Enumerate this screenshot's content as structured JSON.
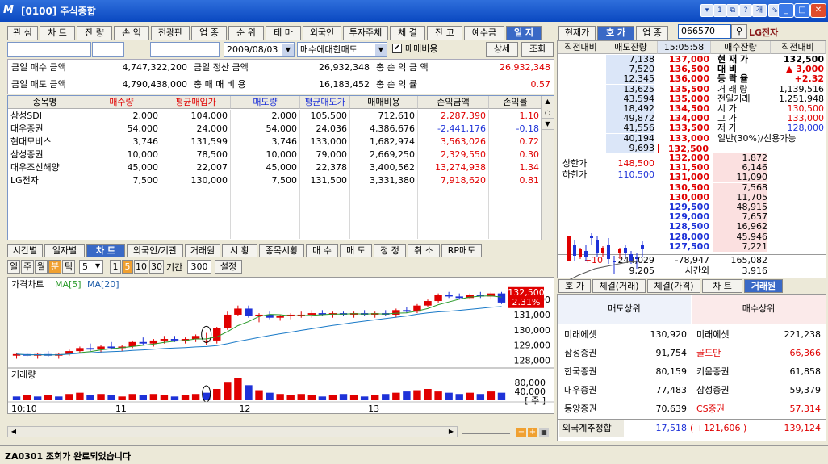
{
  "window": {
    "logo": "M",
    "title": "[0100] 주식종합",
    "tb_icons": [
      "▾",
      "1",
      "⧉",
      "?",
      "개",
      "⇘"
    ],
    "controls": [
      "_",
      "□",
      "✕"
    ]
  },
  "top_tabs": [
    "관 심",
    "차 트",
    "잔 량",
    "손 익",
    "전광판",
    "업 종",
    "순 위",
    "테 마",
    "외국인",
    "투자주체",
    "체 결",
    "잔 고",
    "예수금",
    "일 지"
  ],
  "toolbar": {
    "date": "2009/08/03",
    "mode": "매수에대한매도",
    "checkbox_label": "매매비용",
    "checked": true,
    "detail_btn": "상세",
    "query_btn": "조회"
  },
  "summary": [
    {
      "l1": "금일 매수 금액",
      "v1": "4,747,322,200",
      "l2": "금일 정산 금액",
      "v2": "26,932,348",
      "l3": "총 손 익 금 액",
      "v3": "26,932,348"
    },
    {
      "l1": "금일 매도 금액",
      "v1": "4,790,438,000",
      "l2": "총 매 매 비 용",
      "v2": "16,183,452",
      "l3": "총 손 익 률",
      "v3": "0.57"
    }
  ],
  "table": {
    "headers": [
      "종목명",
      "매수량",
      "평균매입가",
      "매도량",
      "평균매도가",
      "매매비용",
      "손익금액",
      "손익률"
    ],
    "rows": [
      [
        "삼성SDI",
        "2,000",
        "104,000",
        "2,000",
        "105,500",
        "712,610",
        "2,287,390",
        "1.10"
      ],
      [
        "대우증권",
        "54,000",
        "24,000",
        "54,000",
        "24,036",
        "4,386,676",
        "-2,441,176",
        "-0.18"
      ],
      [
        "현대모비스",
        "3,746",
        "131,599",
        "3,746",
        "133,000",
        "1,682,974",
        "3,563,026",
        "0.72"
      ],
      [
        "삼성증권",
        "10,000",
        "78,500",
        "10,000",
        "79,000",
        "2,669,250",
        "2,329,550",
        "0.30"
      ],
      [
        "대우조선해양",
        "45,000",
        "22,007",
        "45,000",
        "22,378",
        "3,400,562",
        "13,274,938",
        "1.34"
      ],
      [
        "LG전자",
        "7,500",
        "130,000",
        "7,500",
        "131,500",
        "3,331,380",
        "7,918,620",
        "0.81"
      ]
    ]
  },
  "chart_tabs": [
    "시간별",
    "일자별",
    "차 트",
    "외국인/기관",
    "거래원",
    "시 황",
    "종목시황",
    "매 수",
    "매 도",
    "정 정",
    "취 소",
    "RP매도"
  ],
  "chart_toolbar": {
    "periods": [
      "일",
      "주",
      "월",
      "분",
      "틱"
    ],
    "n": "5",
    "mins": [
      "1",
      "5",
      "10",
      "30"
    ],
    "span_label": "기간",
    "span": "300",
    "set_btn": "설정"
  },
  "chart_data": [
    {
      "type": "candlestick",
      "title": "가격차트",
      "legend": [
        "MA[5]",
        "MA[20]"
      ],
      "yticks": [
        128000,
        129000,
        130000,
        131000,
        132000
      ],
      "ylim": [
        127700,
        132700
      ],
      "price_tag": "132,500",
      "pct_tag": "2.31%",
      "xlabels": [
        "10:10",
        "11",
        "12",
        "13"
      ],
      "candles": [
        [
          128300,
          128500,
          128100,
          128400
        ],
        [
          128400,
          128500,
          128200,
          128300
        ],
        [
          128300,
          128500,
          128100,
          128400
        ],
        [
          128400,
          128600,
          128200,
          128300
        ],
        [
          128300,
          128500,
          128100,
          128400
        ],
        [
          128400,
          128700,
          128300,
          128600
        ],
        [
          128600,
          128900,
          128500,
          128800
        ],
        [
          128800,
          129100,
          128600,
          128700
        ],
        [
          128700,
          129000,
          128500,
          128900
        ],
        [
          128900,
          129200,
          128700,
          128800
        ],
        [
          128800,
          129000,
          128600,
          128900
        ],
        [
          128900,
          129300,
          128800,
          129200
        ],
        [
          129200,
          129500,
          129000,
          129100
        ],
        [
          129100,
          129400,
          128900,
          129300
        ],
        [
          129300,
          129600,
          129100,
          129400
        ],
        [
          129400,
          129600,
          129200,
          129300
        ],
        [
          129300,
          129500,
          129100,
          129400
        ],
        [
          129400,
          129700,
          129200,
          129600
        ],
        [
          129300,
          129800,
          129000,
          129300
        ],
        [
          129300,
          130200,
          129100,
          130100
        ],
        [
          130100,
          131200,
          130000,
          131000
        ],
        [
          131000,
          131600,
          130900,
          131400
        ],
        [
          131400,
          131600,
          130800,
          130900
        ],
        [
          130900,
          131100,
          130500,
          131000
        ],
        [
          131000,
          131200,
          130700,
          130800
        ],
        [
          130800,
          131000,
          130600,
          130900
        ],
        [
          130900,
          131100,
          130700,
          131000
        ],
        [
          131000,
          131200,
          130800,
          131000
        ],
        [
          131000,
          131300,
          130800,
          131100
        ],
        [
          131100,
          131300,
          130900,
          131000
        ],
        [
          131000,
          131200,
          130800,
          131100
        ],
        [
          131100,
          131200,
          130900,
          131000
        ],
        [
          131000,
          131200,
          130800,
          131100
        ],
        [
          131100,
          131300,
          130900,
          131000
        ],
        [
          131000,
          131200,
          130800,
          131100
        ],
        [
          131100,
          131300,
          130900,
          131000
        ],
        [
          131000,
          131400,
          130800,
          131300
        ],
        [
          131300,
          131500,
          131100,
          131200
        ],
        [
          131200,
          131700,
          131100,
          131600
        ],
        [
          131600,
          132000,
          131500,
          131900
        ],
        [
          131900,
          132400,
          131800,
          132300
        ],
        [
          132300,
          132500,
          132100,
          132200
        ],
        [
          132200,
          132400,
          132000,
          132100
        ],
        [
          132100,
          132400,
          132000,
          132300
        ],
        [
          132300,
          132500,
          132100,
          132200
        ],
        [
          132200,
          132500,
          132000,
          132400
        ],
        [
          132400,
          132500,
          131700,
          131800
        ]
      ]
    },
    {
      "type": "bar",
      "title": "거래량",
      "yticks": [
        "80,000",
        "40,000",
        "[ 주 ]"
      ],
      "values": [
        3,
        4,
        3,
        4,
        3,
        5,
        6,
        4,
        5,
        4,
        3,
        5,
        4,
        5,
        4,
        3,
        4,
        5,
        6,
        9,
        14,
        18,
        12,
        8,
        6,
        5,
        4,
        5,
        4,
        3,
        4,
        5,
        4,
        3,
        4,
        5,
        6,
        7,
        8,
        9,
        7,
        6,
        5,
        6,
        5,
        7,
        6
      ],
      "colors": [
        "b",
        "r",
        "b",
        "r",
        "b",
        "r",
        "r",
        "b",
        "r",
        "b",
        "r",
        "r",
        "b",
        "r",
        "r",
        "b",
        "r",
        "r",
        "b",
        "r",
        "r",
        "r",
        "b",
        "r",
        "b",
        "r",
        "r",
        "r",
        "r",
        "b",
        "r",
        "b",
        "r",
        "b",
        "r",
        "b",
        "r",
        "b",
        "r",
        "r",
        "r",
        "b",
        "b",
        "r",
        "b",
        "r",
        "b"
      ]
    }
  ],
  "right": {
    "tabs": [
      "현재가",
      "호 가",
      "업 종"
    ],
    "code": "066570",
    "name": "LG전자",
    "ob_headers": [
      "직전대비",
      "매도잔량",
      "15:05:58",
      "매수잔량",
      "직전대비"
    ],
    "asks": [
      [
        "7,138",
        "137,000"
      ],
      [
        "7,520",
        "136,500"
      ],
      [
        "12,345",
        "136,000"
      ],
      [
        "13,625",
        "135,500"
      ],
      [
        "43,594",
        "135,000"
      ],
      [
        "18,492",
        "134,500"
      ],
      [
        "49,872",
        "134,000"
      ],
      [
        "41,556",
        "133,500"
      ],
      [
        "40,194",
        "133,000"
      ],
      [
        "9,693",
        "132,500"
      ]
    ],
    "bids": [
      [
        "132,000",
        "1,872"
      ],
      [
        "131,500",
        "6,146"
      ],
      [
        "131,000",
        "11,090"
      ],
      [
        "130,500",
        "7,568"
      ],
      [
        "130,000",
        "11,705"
      ],
      [
        "129,500",
        "48,915"
      ],
      [
        "129,000",
        "7,657"
      ],
      [
        "128,500",
        "16,962"
      ],
      [
        "128,000",
        "45,946"
      ],
      [
        "127,500",
        "7,221"
      ]
    ],
    "info": [
      [
        "현 재 가",
        "132,500"
      ],
      [
        "대 비",
        "▲ 3,000"
      ],
      [
        "등 락 율",
        "+2.32"
      ],
      [
        "거 래 량",
        "1,139,516"
      ],
      [
        "전일거래",
        "1,251,948"
      ],
      [
        "시 가",
        "130,500"
      ],
      [
        "고 가",
        "133,000"
      ],
      [
        "저 가",
        "128,000"
      ],
      [
        "일반(30%)/신용가능",
        ""
      ]
    ],
    "upper": [
      "상한가",
      "148,500"
    ],
    "lower": [
      "하한가",
      "110,500"
    ],
    "totals": {
      "left": "+10",
      "ask": "244,029",
      "mid": "-78,947",
      "bid": "165,082"
    },
    "totals2": {
      "ask": "9,205",
      "mid": "시간외",
      "bid": "3,916"
    },
    "bottom_tabs": [
      "호 가",
      "체결(거래)",
      "체결(가격)",
      "차 트",
      "거래원"
    ],
    "broker_headers": [
      "매도상위",
      "매수상위"
    ],
    "brokers": [
      [
        "미래에셋",
        "130,920",
        "미래에셋",
        "221,238"
      ],
      [
        "삼성증권",
        "91,754",
        "골드만",
        "66,366"
      ],
      [
        "한국증권",
        "80,159",
        "키움증권",
        "61,858"
      ],
      [
        "대우증권",
        "77,483",
        "삼성증권",
        "59,379"
      ],
      [
        "동양증권",
        "70,639",
        "CS증권",
        "57,314"
      ]
    ],
    "foreign": {
      "label": "외국계추정합",
      "sell": "17,518",
      "diff": "( +121,606 )",
      "buy": "139,124"
    }
  },
  "status": "ZA0301 조회가 완료되었습니다",
  "colors": {
    "up": "#e00000",
    "down": "#1e32d8",
    "title": "#0a48c0"
  }
}
